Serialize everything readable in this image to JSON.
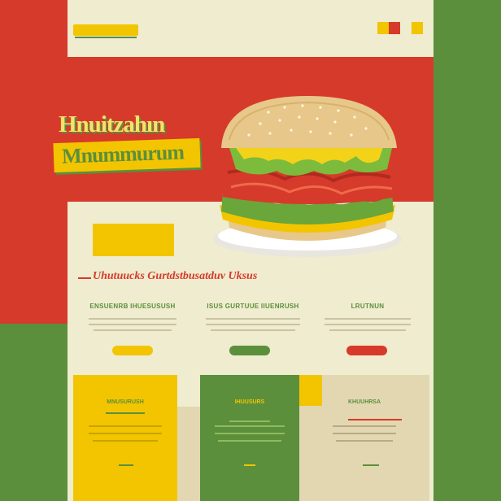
{
  "colors": {
    "red": "#d63a2a",
    "green": "#5c8f3c",
    "yellow": "#f2c500",
    "cream": "#efeccf",
    "tan": "#e3d7b1"
  },
  "header": {
    "logo_text": "",
    "nav": [
      "",
      "",
      "",
      ""
    ],
    "swatches": [
      "#f2c500",
      "#d63a2a",
      "#efeccf",
      "#f2c500"
    ]
  },
  "hero": {
    "title_line_1": "Hnuitzahın",
    "title_line_2": "Mnummurum",
    "cta_label": "",
    "image": "burger-illustration"
  },
  "tagline": "Uhutuucks Gurtdstbusatduv Uksus",
  "features": [
    {
      "title": "Ensuenrb Ihuesusush",
      "button_color": "#f2c500"
    },
    {
      "title": "Isus Gurtuue Iiuenrush",
      "button_color": "#5c8f3c"
    },
    {
      "title": "Lrutnun",
      "button_color": "#d63a2a"
    }
  ],
  "cards": [
    {
      "title": "Mnusurush",
      "bg": "#f2c500",
      "title_color": "#5c8f3c"
    },
    {
      "title": "Ihuusurs",
      "bg": "#5c8f3c",
      "title_color": "#f2c500"
    },
    {
      "title": "Khuuhrsa",
      "bg": "#e3d7b1",
      "title_color": "#5c8f3c"
    }
  ]
}
